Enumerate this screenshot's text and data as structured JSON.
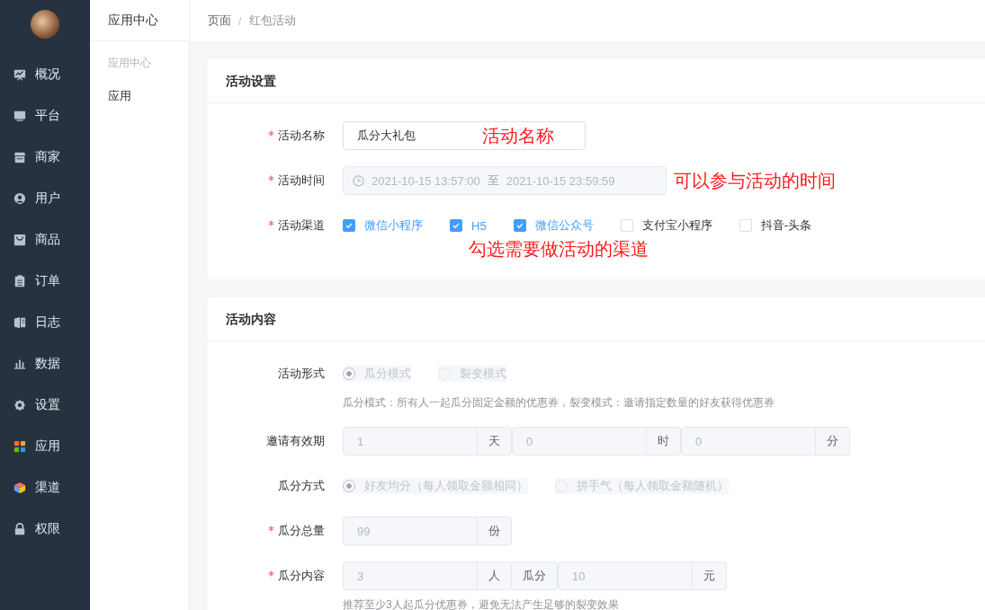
{
  "sidebar": {
    "items": [
      {
        "label": "概况"
      },
      {
        "label": "平台"
      },
      {
        "label": "商家"
      },
      {
        "label": "用户"
      },
      {
        "label": "商品"
      },
      {
        "label": "订单"
      },
      {
        "label": "日志"
      },
      {
        "label": "数据"
      },
      {
        "label": "设置"
      },
      {
        "label": "应用"
      },
      {
        "label": "渠道"
      },
      {
        "label": "权限"
      }
    ]
  },
  "subnav": {
    "title": "应用中心",
    "group": "应用中心",
    "items": [
      {
        "label": "应用"
      }
    ]
  },
  "breadcrumb": {
    "items": [
      "页面",
      "红包活动"
    ],
    "separator": "/"
  },
  "sections": [
    {
      "title": "活动设置",
      "fields": [
        {
          "kind": "text",
          "label": "活动名称",
          "required": true,
          "disabled": false,
          "value": "瓜分大礼包",
          "annotation": "活动名称"
        },
        {
          "kind": "daterange",
          "label": "活动时间",
          "required": true,
          "disabled": true,
          "start": "2021-10-15 13:57:00",
          "separator": "至",
          "end": "2021-10-15 23:59:59",
          "annotation": "可以参与活动的时间"
        },
        {
          "kind": "checkboxes",
          "label": "活动渠道",
          "required": true,
          "disabled": false,
          "options": [
            {
              "label": "微信小程序",
              "checked": true
            },
            {
              "label": "H5",
              "checked": true
            },
            {
              "label": "微信公众号",
              "checked": true
            },
            {
              "label": "支付宝小程序",
              "checked": false
            },
            {
              "label": "抖音-头条",
              "checked": false
            }
          ],
          "annotation": "勾选需要做活动的渠道"
        }
      ]
    },
    {
      "title": "活动内容",
      "fields": [
        {
          "kind": "radios",
          "label": "活动形式",
          "required": false,
          "disabled": true,
          "options": [
            {
              "label": "瓜分模式",
              "selected": true
            },
            {
              "label": "裂变模式",
              "selected": false
            }
          ],
          "help": "瓜分模式：所有人一起瓜分固定金额的优惠券，裂变模式：邀请指定数量的好友获得优惠券"
        },
        {
          "kind": "group",
          "label": "邀请有效期",
          "required": false,
          "disabled": true,
          "parts": [
            {
              "kind": "input",
              "value": "1"
            },
            {
              "kind": "addon",
              "text": "天"
            },
            {
              "kind": "input",
              "value": "0"
            },
            {
              "kind": "addon",
              "text": "时"
            },
            {
              "kind": "input",
              "value": "0"
            },
            {
              "kind": "addon",
              "text": "分"
            }
          ]
        },
        {
          "kind": "radios",
          "label": "瓜分方式",
          "required": false,
          "disabled": true,
          "options": [
            {
              "label": "好友均分（每人领取金额相同）",
              "selected": true
            },
            {
              "label": "拼手气（每人领取金额随机）",
              "selected": false
            }
          ]
        },
        {
          "kind": "group",
          "label": "瓜分总量",
          "required": true,
          "disabled": true,
          "parts": [
            {
              "kind": "input",
              "value": "99"
            },
            {
              "kind": "addon",
              "text": "份"
            }
          ]
        },
        {
          "kind": "group",
          "label": "瓜分内容",
          "required": true,
          "disabled": true,
          "parts": [
            {
              "kind": "input",
              "value": "3"
            },
            {
              "kind": "addon",
              "text": "人"
            },
            {
              "kind": "addon",
              "text": "瓜分"
            },
            {
              "kind": "input",
              "value": "10"
            },
            {
              "kind": "addon",
              "text": "元"
            }
          ],
          "help": "推荐至少3人起瓜分优惠券，避免无法产生足够的裂变效果"
        }
      ]
    }
  ]
}
